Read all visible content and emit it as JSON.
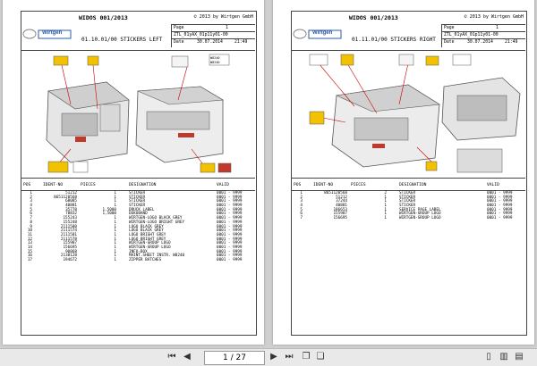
{
  "pages": [
    {
      "doc_title": "WIDOS 001/2013",
      "copyright": "© 2013 by Wirtgen GmbH",
      "logo_text": "Wirtgen",
      "section_title": "01.10.01/00 STICKERS LEFT",
      "page_label": "Page",
      "page_value": "1",
      "code": "ZTL_01yAX_01p11y01-00",
      "date_label": "Date",
      "date_value": "30.07.2014",
      "time_value": "21:49",
      "columns": [
        "POS",
        "IDENT-NO",
        "PIECES",
        "DESIGNATION",
        "VALID"
      ],
      "rows": [
        [
          "1",
          "51212",
          "1",
          "STICKER",
          "0001 - 9999"
        ],
        [
          "2",
          "8651120568",
          "1",
          "STICKER",
          "0001 - 9999"
        ],
        [
          "3",
          "68085",
          "1",
          "STICKER",
          "0001 - 9999"
        ],
        [
          "4",
          "40881",
          "1",
          "STICKER",
          "0001 - 9999"
        ],
        [
          "5",
          "35778",
          "1,5000",
          "DRUCK LABEL",
          "0001 - 9999"
        ],
        [
          "6",
          "78832",
          "1,5000",
          "DEKOBAND",
          "0001 - 9999"
        ],
        [
          "7",
          "155243",
          "1",
          "WIRTGEN-LOGO BLACK GREY",
          "0001 - 9999"
        ],
        [
          "8",
          "155248",
          "1",
          "WIRTGEN-LOGO BRIGHT GREY",
          "0001 - 9999"
        ],
        [
          "9",
          "2111580",
          "1",
          "LOGO BLACK GREY",
          "0001 - 9999"
        ],
        [
          "10",
          "2111574",
          "1",
          "LOGO BLACK GREY",
          "0001 - 9999"
        ],
        [
          "11",
          "2111581",
          "1",
          "LOGO BRIGHT GREY",
          "0001 - 9999"
        ],
        [
          "12",
          "2111578",
          "1",
          "LOGO BRIGHT GREY",
          "0001 - 9999"
        ],
        [
          "13",
          "155987",
          "1",
          "WIRTGEN-GROUP LOGO",
          "0001 - 9999"
        ],
        [
          "14",
          "156695",
          "1",
          "WIRTGEN-GROUP LOGO",
          "0001 - 9999"
        ],
        [
          "15",
          "90868",
          "1",
          "INFO-BOX",
          "0001 - 9999"
        ],
        [
          "16",
          "2138128",
          "1",
          "MAINT.SHEET INSTR. W8240",
          "0001 - 9999"
        ],
        [
          "17",
          "194672",
          "1",
          "ZIPPER BATCHES",
          "0001 - 9999"
        ]
      ],
      "sticker_codes": [
        "W8240",
        "W8240"
      ]
    },
    {
      "doc_title": "WIDOS 001/2013",
      "copyright": "© 2013 by Wirtgen GmbH",
      "logo_text": "Wirtgen",
      "section_title": "01.11.01/00 STICKERS RIGHT",
      "page_label": "Page",
      "page_value": "1",
      "code": "ZTL_01yAX_01p11y01-00",
      "date_label": "Date",
      "date_value": "30.07.2014",
      "time_value": "21:49",
      "columns": [
        "POS",
        "IDENT-NO",
        "PIECES",
        "DESIGNATION",
        "VALID"
      ],
      "rows": [
        [
          "1",
          "8651120568",
          "2",
          "STICKER",
          "0001 - 9999"
        ],
        [
          "2",
          "51212",
          "1",
          "STICKER",
          "0001 - 9999"
        ],
        [
          "3",
          "37244",
          "1",
          "STICKER",
          "0001 - 9999"
        ],
        [
          "4",
          "40881",
          "1",
          "STICKER",
          "0001 - 9999"
        ],
        [
          "5",
          "186653",
          "1",
          "SERVICE PAGE LABEL",
          "0001 - 9999"
        ],
        [
          "6",
          "155987",
          "1",
          "WIRTGEN-GROUP LOGO",
          "0001 - 9999"
        ],
        [
          "7",
          "156695",
          "1",
          "WIRTGEN-GROUP LOGO",
          "0001 - 9999"
        ]
      ]
    }
  ],
  "toolbar": {
    "page_indicator": "1 / 27",
    "icons": [
      "first-page-icon",
      "prev-page-icon",
      "next-page-icon",
      "last-page-icon",
      "page-copy-icon",
      "page-paste-icon",
      "single-page-view-icon",
      "double-page-view-icon",
      "fit-width-icon"
    ]
  },
  "colors": {
    "background": "#cfcfcf",
    "sticker_yellow": "#f2c200",
    "logo_blue": "#2b5aa8"
  }
}
